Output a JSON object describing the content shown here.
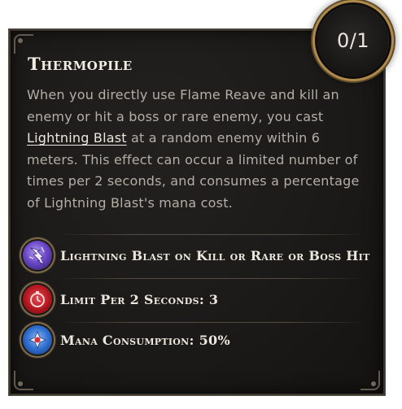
{
  "skill": {
    "title": "Thermopile",
    "points": "0/1",
    "description": {
      "part1": "When you directly use Flame Reave and kill an enemy or hit a boss or rare enemy, you cast ",
      "link": "Lightning Blast",
      "part2": " at a random enemy within 6 meters. This effect can occur a limited number of times per 2 seconds, and consumes a percentage of Lightning Blast's mana cost."
    }
  },
  "stats": [
    {
      "label": "Lightning Blast on Kill or Rare or Boss Hit",
      "icon": "lightning-blast-icon",
      "color": "#7b5cd6"
    },
    {
      "label": "Limit Per 2 Seconds: 3",
      "icon": "stopwatch-icon",
      "color": "#c2212a"
    },
    {
      "label": "Mana Consumption: 50%",
      "icon": "mana-icon",
      "color": "#2f6fd0"
    }
  ]
}
